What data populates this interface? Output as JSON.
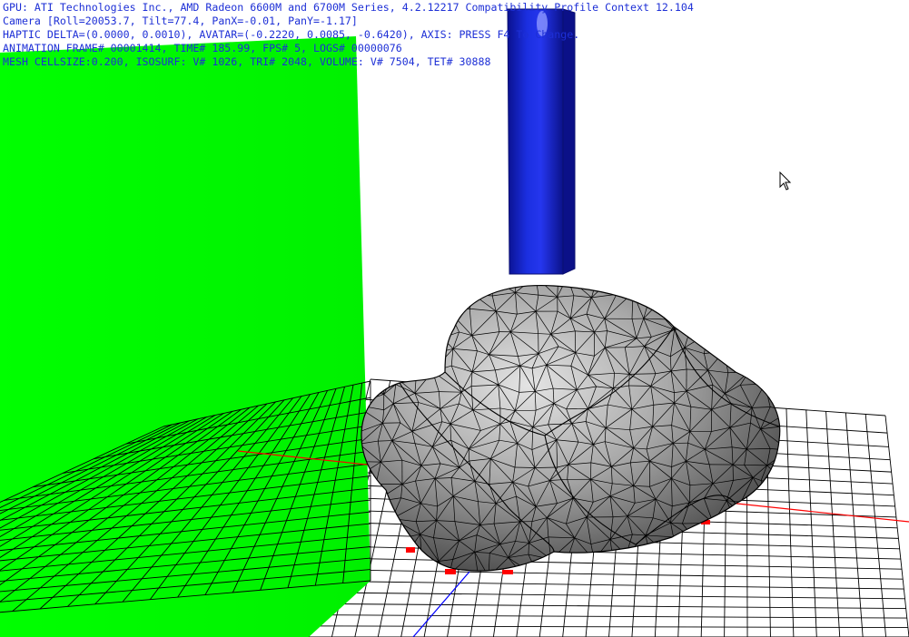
{
  "hud": {
    "line1": "GPU: ATI Technologies Inc., AMD Radeon 6600M and 6700M Series, 4.2.12217 Compatibility Profile Context 12.104",
    "line2": "Camera [Roll=20053.7, Tilt=77.4, PanX=-0.01, PanY=-1.17]",
    "line3": "HAPTIC DELTA=(0.0000, 0.0010), AVATAR=(-0.2220, 0.0085, -0.6420), AXIS: PRESS F4 To Change.",
    "line4": "ANIMATION FRAME# 00001414, TIME# 185.99, FPS# 5, LOGS# 00000076",
    "line5": "MESH CELLSIZE:0.200, ISOSURF: V# 1026, TRI# 2048, VOLUME: V# 7504, TET# 30888"
  },
  "scene": {
    "background_color": "#ffffff",
    "wall_color": "#00ff00",
    "floor_color": "#ffffff",
    "grid_color": "#000000",
    "x_axis_color": "#ff0000",
    "z_axis_color": "#0000ff",
    "avatar_color": "#0a14c8",
    "mesh_fill_color": "#8c8c8c",
    "mesh_edge_color": "#000000"
  },
  "icons": {
    "cursor": "mouse-pointer-icon"
  }
}
